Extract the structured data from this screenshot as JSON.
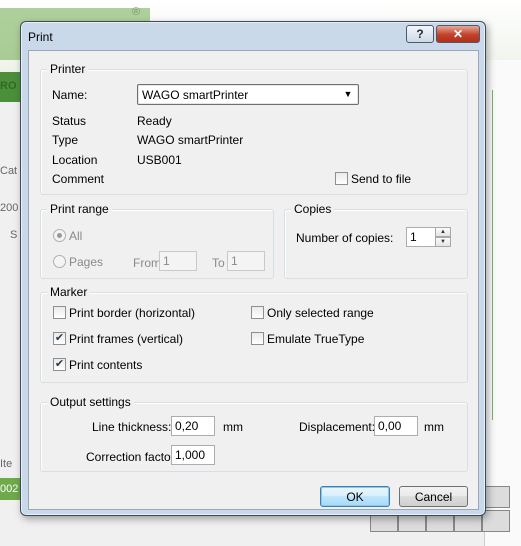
{
  "background": {
    "logo_reg": "®",
    "left_fragments": [
      "RO",
      "Cat",
      "200",
      "S",
      "Ite",
      "002"
    ]
  },
  "dialog": {
    "title": "Print",
    "help_button": "?",
    "close_button": "✕",
    "printer": {
      "legend": "Printer",
      "name_label": "Name:",
      "name_value": "WAGO smartPrinter",
      "status_label": "Status",
      "status_value": "Ready",
      "type_label": "Type",
      "type_value": "WAGO smartPrinter",
      "location_label": "Location",
      "location_value": "USB001",
      "comment_label": "Comment",
      "send_to_file_label": "Send to file",
      "send_to_file_checked": false
    },
    "print_range": {
      "legend": "Print range",
      "all_label": "All",
      "all_selected": true,
      "pages_label": "Pages",
      "from_label": "From",
      "from_value": "1",
      "to_label": "To",
      "to_value": "1"
    },
    "copies": {
      "legend": "Copies",
      "number_label": "Number of copies:",
      "number_value": "1"
    },
    "marker": {
      "legend": "Marker",
      "print_border_label": "Print border (horizontal)",
      "print_border_checked": false,
      "print_frames_label": "Print frames (vertical)",
      "print_frames_checked": true,
      "print_contents_label": "Print contents",
      "print_contents_checked": true,
      "only_selected_label": "Only selected range",
      "only_selected_checked": false,
      "emulate_truetype_label": "Emulate TrueType",
      "emulate_truetype_checked": false
    },
    "output": {
      "legend": "Output settings",
      "line_thickness_label": "Line thickness:",
      "line_thickness_value": "0,20",
      "line_thickness_unit": "mm",
      "displacement_label": "Displacement:",
      "displacement_value": "0,00",
      "displacement_unit": "mm",
      "correction_label": "Correction factor:",
      "correction_value": "1,000"
    },
    "ok_label": "OK",
    "cancel_label": "Cancel",
    "check_mark": "✔"
  }
}
